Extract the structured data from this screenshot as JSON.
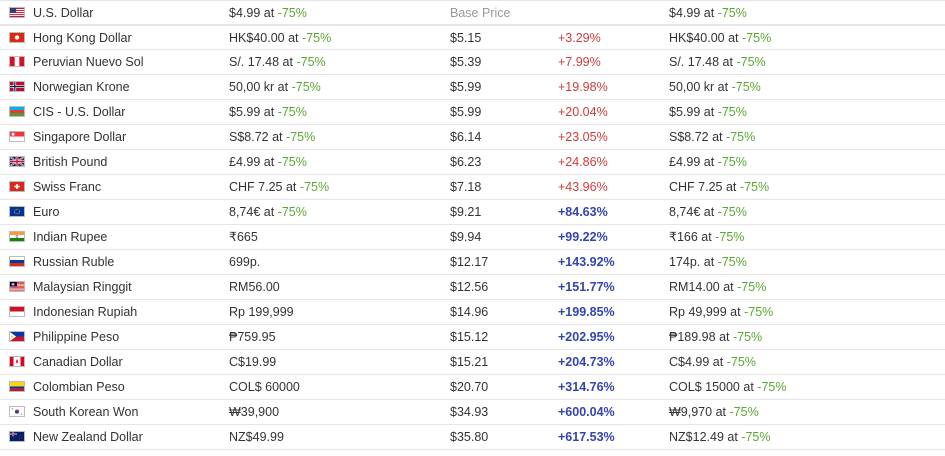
{
  "header": {
    "currency": "U.S. Dollar",
    "price": "$4.99",
    "at": "at",
    "discount": "-75%",
    "base_price_label": "Base Price",
    "final": "$4.99",
    "final_discount": "-75%",
    "flag_colors": [
      "#ffffff",
      "#b22234",
      "#3c3b6e"
    ]
  },
  "rows": [
    {
      "currency": "Hong Kong Dollar",
      "price": "HK$40.00",
      "discount": "-75%",
      "base": "$5.15",
      "diff": "+3.29%",
      "diff_class": "neg",
      "final": "HK$40.00",
      "final_discount": "-75%",
      "flag": "hk"
    },
    {
      "currency": "Peruvian Nuevo Sol",
      "price": "S/. 17.48",
      "discount": "-75%",
      "base": "$5.39",
      "diff": "+7.99%",
      "diff_class": "neg",
      "final": "S/. 17.48",
      "final_discount": "-75%",
      "flag": "pe"
    },
    {
      "currency": "Norwegian Krone",
      "price": "50,00 kr",
      "discount": "-75%",
      "base": "$5.99",
      "diff": "+19.98%",
      "diff_class": "neg",
      "final": "50,00 kr",
      "final_discount": "-75%",
      "flag": "no"
    },
    {
      "currency": "CIS - U.S. Dollar",
      "price": "$5.99",
      "discount": "-75%",
      "base": "$5.99",
      "diff": "+20.04%",
      "diff_class": "neg",
      "final": "$5.99",
      "final_discount": "-75%",
      "flag": "az"
    },
    {
      "currency": "Singapore Dollar",
      "price": "S$8.72",
      "discount": "-75%",
      "base": "$6.14",
      "diff": "+23.05%",
      "diff_class": "neg",
      "final": "S$8.72",
      "final_discount": "-75%",
      "flag": "sg"
    },
    {
      "currency": "British Pound",
      "price": "£4.99",
      "discount": "-75%",
      "base": "$6.23",
      "diff": "+24.86%",
      "diff_class": "neg",
      "final": "£4.99",
      "final_discount": "-75%",
      "flag": "gb"
    },
    {
      "currency": "Swiss Franc",
      "price": "CHF 7.25",
      "discount": "-75%",
      "base": "$7.18",
      "diff": "+43.96%",
      "diff_class": "neg",
      "final": "CHF 7.25",
      "final_discount": "-75%",
      "flag": "ch"
    },
    {
      "currency": "Euro",
      "price": "8,74€",
      "discount": "-75%",
      "base": "$9.21",
      "diff": "+84.63%",
      "diff_class": "pos",
      "final": "8,74€",
      "final_discount": "-75%",
      "flag": "eu"
    },
    {
      "currency": "Indian Rupee",
      "price": "₹665",
      "discount": "",
      "base": "$9.94",
      "diff": "+99.22%",
      "diff_class": "pos",
      "final": "₹166",
      "final_discount": "-75%",
      "flag": "in"
    },
    {
      "currency": "Russian Ruble",
      "price": "699p.",
      "discount": "",
      "base": "$12.17",
      "diff": "+143.92%",
      "diff_class": "pos",
      "final": "174p.",
      "final_discount": "-75%",
      "flag": "ru"
    },
    {
      "currency": "Malaysian Ringgit",
      "price": "RM56.00",
      "discount": "",
      "base": "$12.56",
      "diff": "+151.77%",
      "diff_class": "pos",
      "final": "RM14.00",
      "final_discount": "-75%",
      "flag": "my"
    },
    {
      "currency": "Indonesian Rupiah",
      "price": "Rp 199,999",
      "discount": "",
      "base": "$14.96",
      "diff": "+199.85%",
      "diff_class": "pos",
      "final": "Rp 49,999",
      "final_discount": "-75%",
      "flag": "id"
    },
    {
      "currency": "Philippine Peso",
      "price": "₱759.95",
      "discount": "",
      "base": "$15.12",
      "diff": "+202.95%",
      "diff_class": "pos",
      "final": "₱189.98",
      "final_discount": "-75%",
      "flag": "ph"
    },
    {
      "currency": "Canadian Dollar",
      "price": "C$19.99",
      "discount": "",
      "base": "$15.21",
      "diff": "+204.73%",
      "diff_class": "pos",
      "final": "C$4.99",
      "final_discount": "-75%",
      "flag": "ca"
    },
    {
      "currency": "Colombian Peso",
      "price": "COL$ 60000",
      "discount": "",
      "base": "$20.70",
      "diff": "+314.76%",
      "diff_class": "pos",
      "final": "COL$ 15000",
      "final_discount": "-75%",
      "flag": "co"
    },
    {
      "currency": "South Korean Won",
      "price": "₩39,900",
      "discount": "",
      "base": "$34.93",
      "diff": "+600.04%",
      "diff_class": "pos",
      "final": "₩9,970",
      "final_discount": "-75%",
      "flag": "kr"
    },
    {
      "currency": "New Zealand Dollar",
      "price": "NZ$49.99",
      "discount": "",
      "base": "$35.80",
      "diff": "+617.53%",
      "diff_class": "pos",
      "final": "NZ$12.49",
      "final_discount": "-75%",
      "flag": "nz"
    }
  ],
  "at_word": "at"
}
